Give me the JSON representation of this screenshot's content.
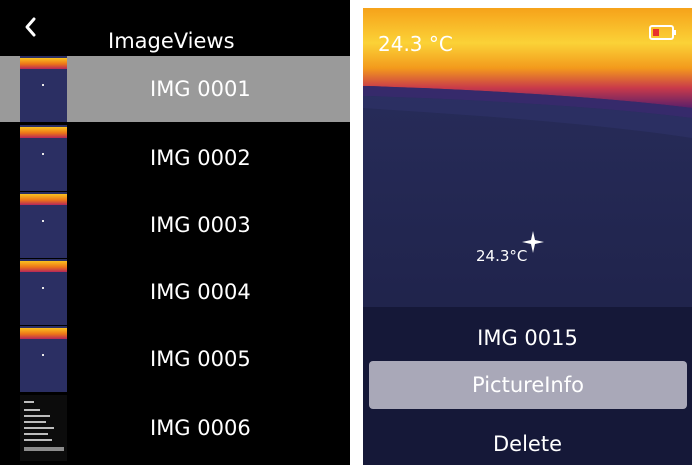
{
  "gallery": {
    "title": "ImageViews",
    "items": [
      {
        "label": "IMG 0001",
        "selected": true
      },
      {
        "label": "IMG 0002",
        "selected": false
      },
      {
        "label": "IMG 0003",
        "selected": false
      },
      {
        "label": "IMG 0004",
        "selected": false
      },
      {
        "label": "IMG 0005",
        "selected": false
      },
      {
        "label": "IMG 0006",
        "selected": false
      }
    ]
  },
  "viewer": {
    "max_temp": "24.3 °C",
    "spot_temp": "24.3°C",
    "battery_icon": "battery-icon",
    "menu": [
      {
        "label": "IMG 0015",
        "highlighted": false
      },
      {
        "label": "PictureInfo",
        "highlighted": true
      },
      {
        "label": "Delete",
        "highlighted": false
      }
    ]
  },
  "colors": {
    "selection": "#9a9a9a",
    "palette_hot": "#f9c21f",
    "palette_cold": "#1e2044"
  }
}
